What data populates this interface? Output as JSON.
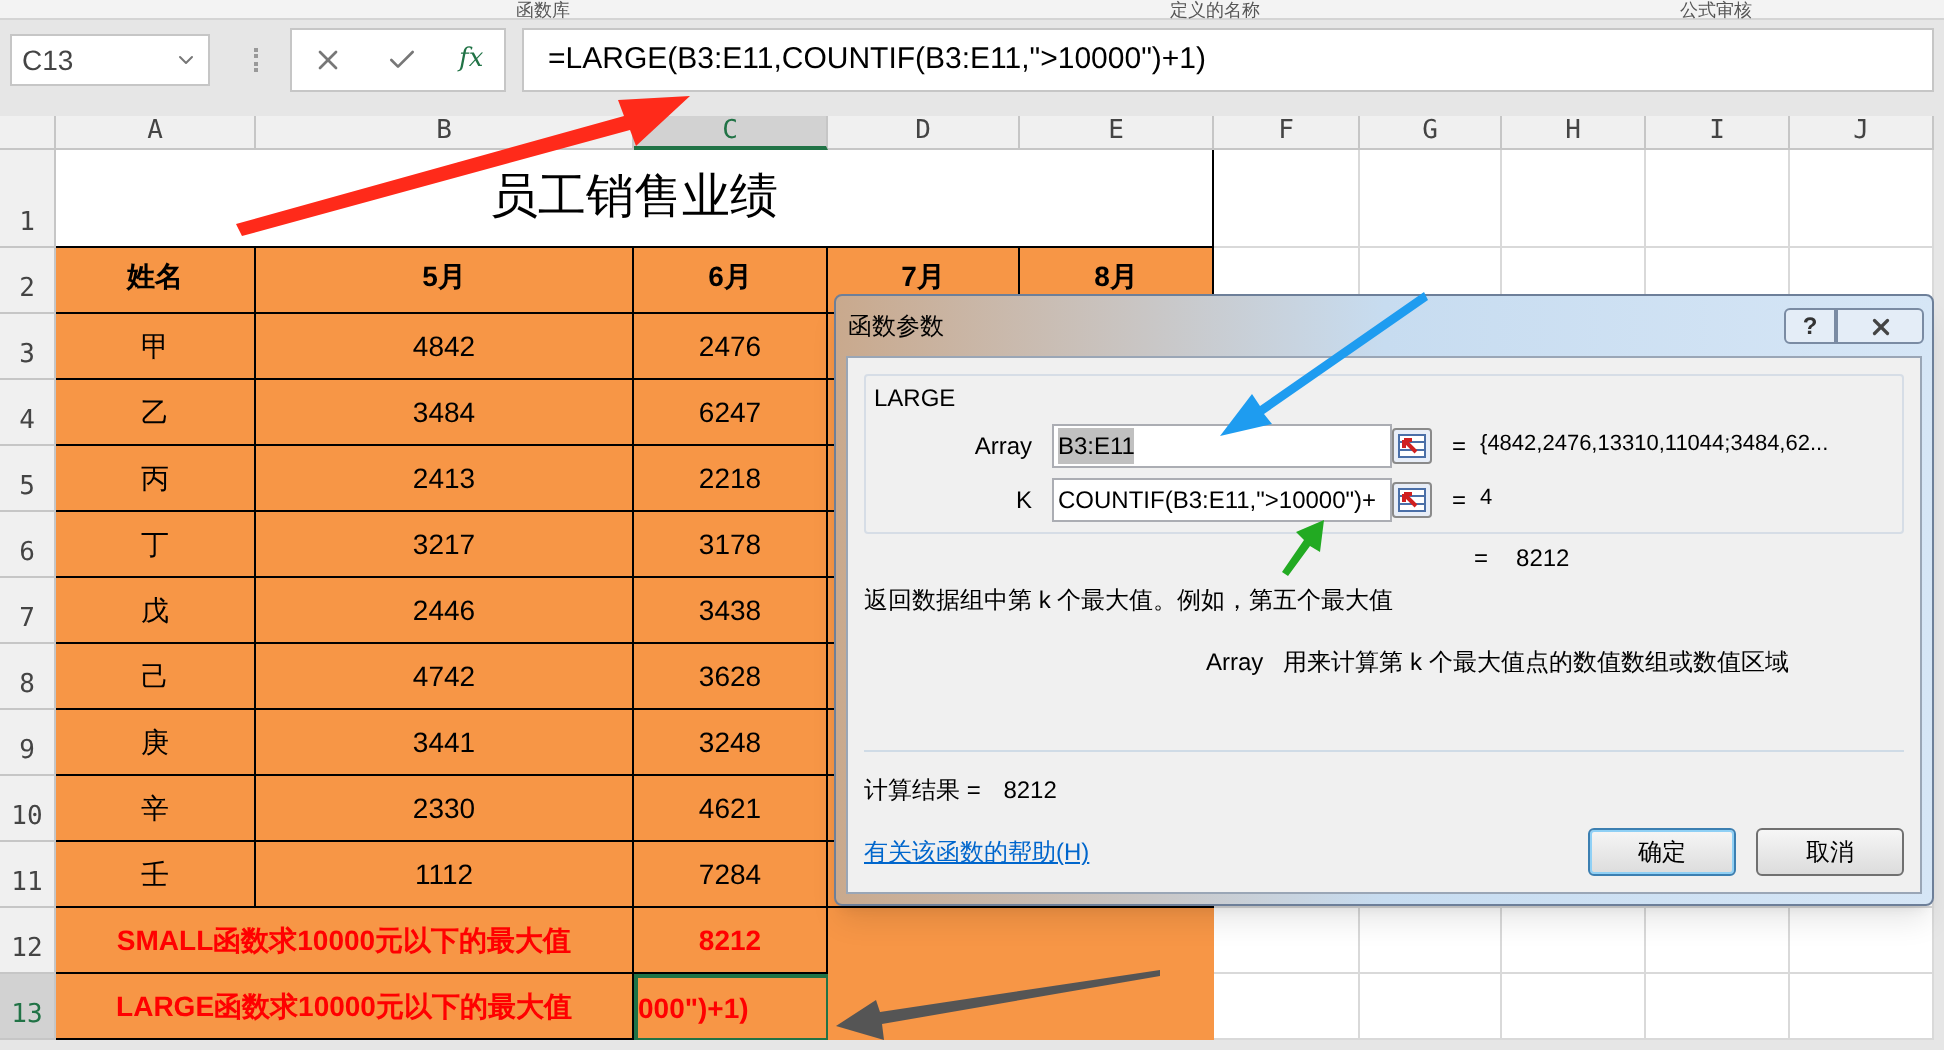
{
  "ribbon_groups": [
    "函数库",
    "定义的名称",
    "公式审核"
  ],
  "name_box": {
    "value": "C13"
  },
  "formula_bar": {
    "fx_label": "fx",
    "formula": "=LARGE(B3:E11,COUNTIF(B3:E11,\">10000\")+1)"
  },
  "columns": [
    {
      "label": "A",
      "selected": false
    },
    {
      "label": "B",
      "selected": false
    },
    {
      "label": "C",
      "selected": true
    },
    {
      "label": "D",
      "selected": false
    },
    {
      "label": "E",
      "selected": false
    },
    {
      "label": "F",
      "selected": false
    },
    {
      "label": "G",
      "selected": false
    },
    {
      "label": "H",
      "selected": false
    },
    {
      "label": "I",
      "selected": false
    },
    {
      "label": "J",
      "selected": false
    }
  ],
  "row_numbers": [
    {
      "label": "1",
      "selected": false
    },
    {
      "label": "2",
      "selected": false
    },
    {
      "label": "3",
      "selected": false
    },
    {
      "label": "4",
      "selected": false
    },
    {
      "label": "5",
      "selected": false
    },
    {
      "label": "6",
      "selected": false
    },
    {
      "label": "7",
      "selected": false
    },
    {
      "label": "8",
      "selected": false
    },
    {
      "label": "9",
      "selected": false
    },
    {
      "label": "10",
      "selected": false
    },
    {
      "label": "11",
      "selected": false
    },
    {
      "label": "12",
      "selected": false
    },
    {
      "label": "13",
      "selected": true
    }
  ],
  "sheet_title": "员工销售业绩",
  "header": [
    "姓名",
    "5月",
    "6月",
    "7月",
    "8月"
  ],
  "rows": [
    [
      "甲",
      "4842",
      "2476"
    ],
    [
      "乙",
      "3484",
      "6247"
    ],
    [
      "丙",
      "2413",
      "2218"
    ],
    [
      "丁",
      "3217",
      "3178"
    ],
    [
      "戊",
      "2446",
      "3438"
    ],
    [
      "己",
      "4742",
      "3628"
    ],
    [
      "庚",
      "3441",
      "3248"
    ],
    [
      "辛",
      "2330",
      "4621"
    ],
    [
      "壬",
      "1112",
      "7284"
    ]
  ],
  "summary": [
    {
      "label": "SMALL函数求10000元以下的最大值",
      "value": "8212",
      "selected": false
    },
    {
      "label": "LARGE函数求10000元以下的最大值",
      "value": "000\")+1)",
      "selected": true
    }
  ],
  "dialog": {
    "title": "函数参数",
    "help_button": "?",
    "function_name": "LARGE",
    "arguments": [
      {
        "name": "Array",
        "value": "B3:E11",
        "equals": "=",
        "result": "{4842,2476,13310,11044;3484,62..."
      },
      {
        "name": "K",
        "value": "COUNTIF(B3:E11,\">10000\")+",
        "equals": "=",
        "result": "4"
      }
    ],
    "formula_equals": "=",
    "formula_value": "8212",
    "description": "返回数据组中第 k 个最大值。例如，第五个最大值",
    "arg_help_name": "Array",
    "arg_help": "用来计算第 k 个最大值点的数值数组或数值区域",
    "result_label": "计算结果 =",
    "result_value": "8212",
    "help_link": "有关该函数的帮助(H)",
    "buttons": [
      {
        "label": "确定",
        "selected": true
      },
      {
        "label": "取消",
        "selected": false
      }
    ]
  }
}
